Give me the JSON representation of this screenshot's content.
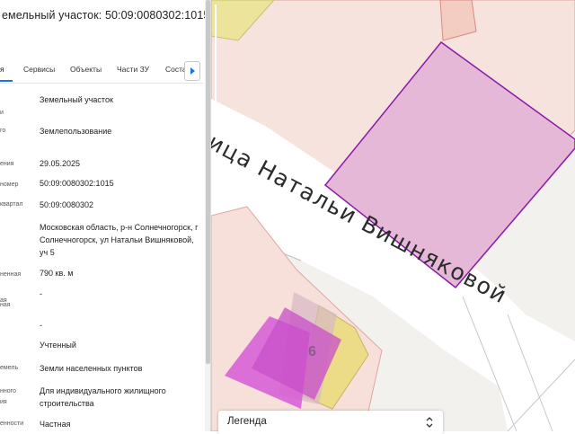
{
  "panel": {
    "title": "емельный участок: 50:09:0080302:1015",
    "tabs": [
      "я",
      "Сервисы",
      "Объекты",
      "Части ЗУ",
      "Соста"
    ],
    "rows": [
      {
        "label": "",
        "value": "Земельный участок"
      },
      {
        "label": "и",
        "value": ""
      },
      {
        "label": "го",
        "value": "Землепользование"
      },
      {
        "label": "ения",
        "value": "29.05.2025"
      },
      {
        "label": "номер",
        "value": "50:09:0080302:1015"
      },
      {
        "label": "квартал",
        "value": "50:09:0080302"
      },
      {
        "label": "",
        "value": "Московская область, р-н Солнечногорск, г Солнечногорск, ул Натальи Вишняковой, уч 5"
      },
      {
        "label": "ненная",
        "value": "790 кв. м"
      },
      {
        "label": "ая",
        "value": "-"
      },
      {
        "label": "ная",
        "value": ""
      },
      {
        "label": "",
        "value": "-"
      },
      {
        "label": "",
        "value": "Учтенный"
      },
      {
        "label": "емель",
        "value": "Земли населенных пунктов"
      },
      {
        "label": "нного",
        "value": "Для индивидуального жилищного строительства"
      },
      {
        "label": "ия",
        "value": ""
      },
      {
        "label": "енности",
        "value": "Частная"
      }
    ]
  },
  "map": {
    "street_name": "лица Натальи Вишняковой",
    "parcel_number": "6"
  },
  "legend": {
    "label": "Легенда"
  },
  "colors": {
    "accent": "#1a73e8",
    "parcel_fill": "#e6b8d8",
    "parcel_stroke": "#8b1aa8",
    "magenta": "#d65bd6",
    "yellow": "#eddc8c",
    "pink_area": "#f7dcd6"
  }
}
